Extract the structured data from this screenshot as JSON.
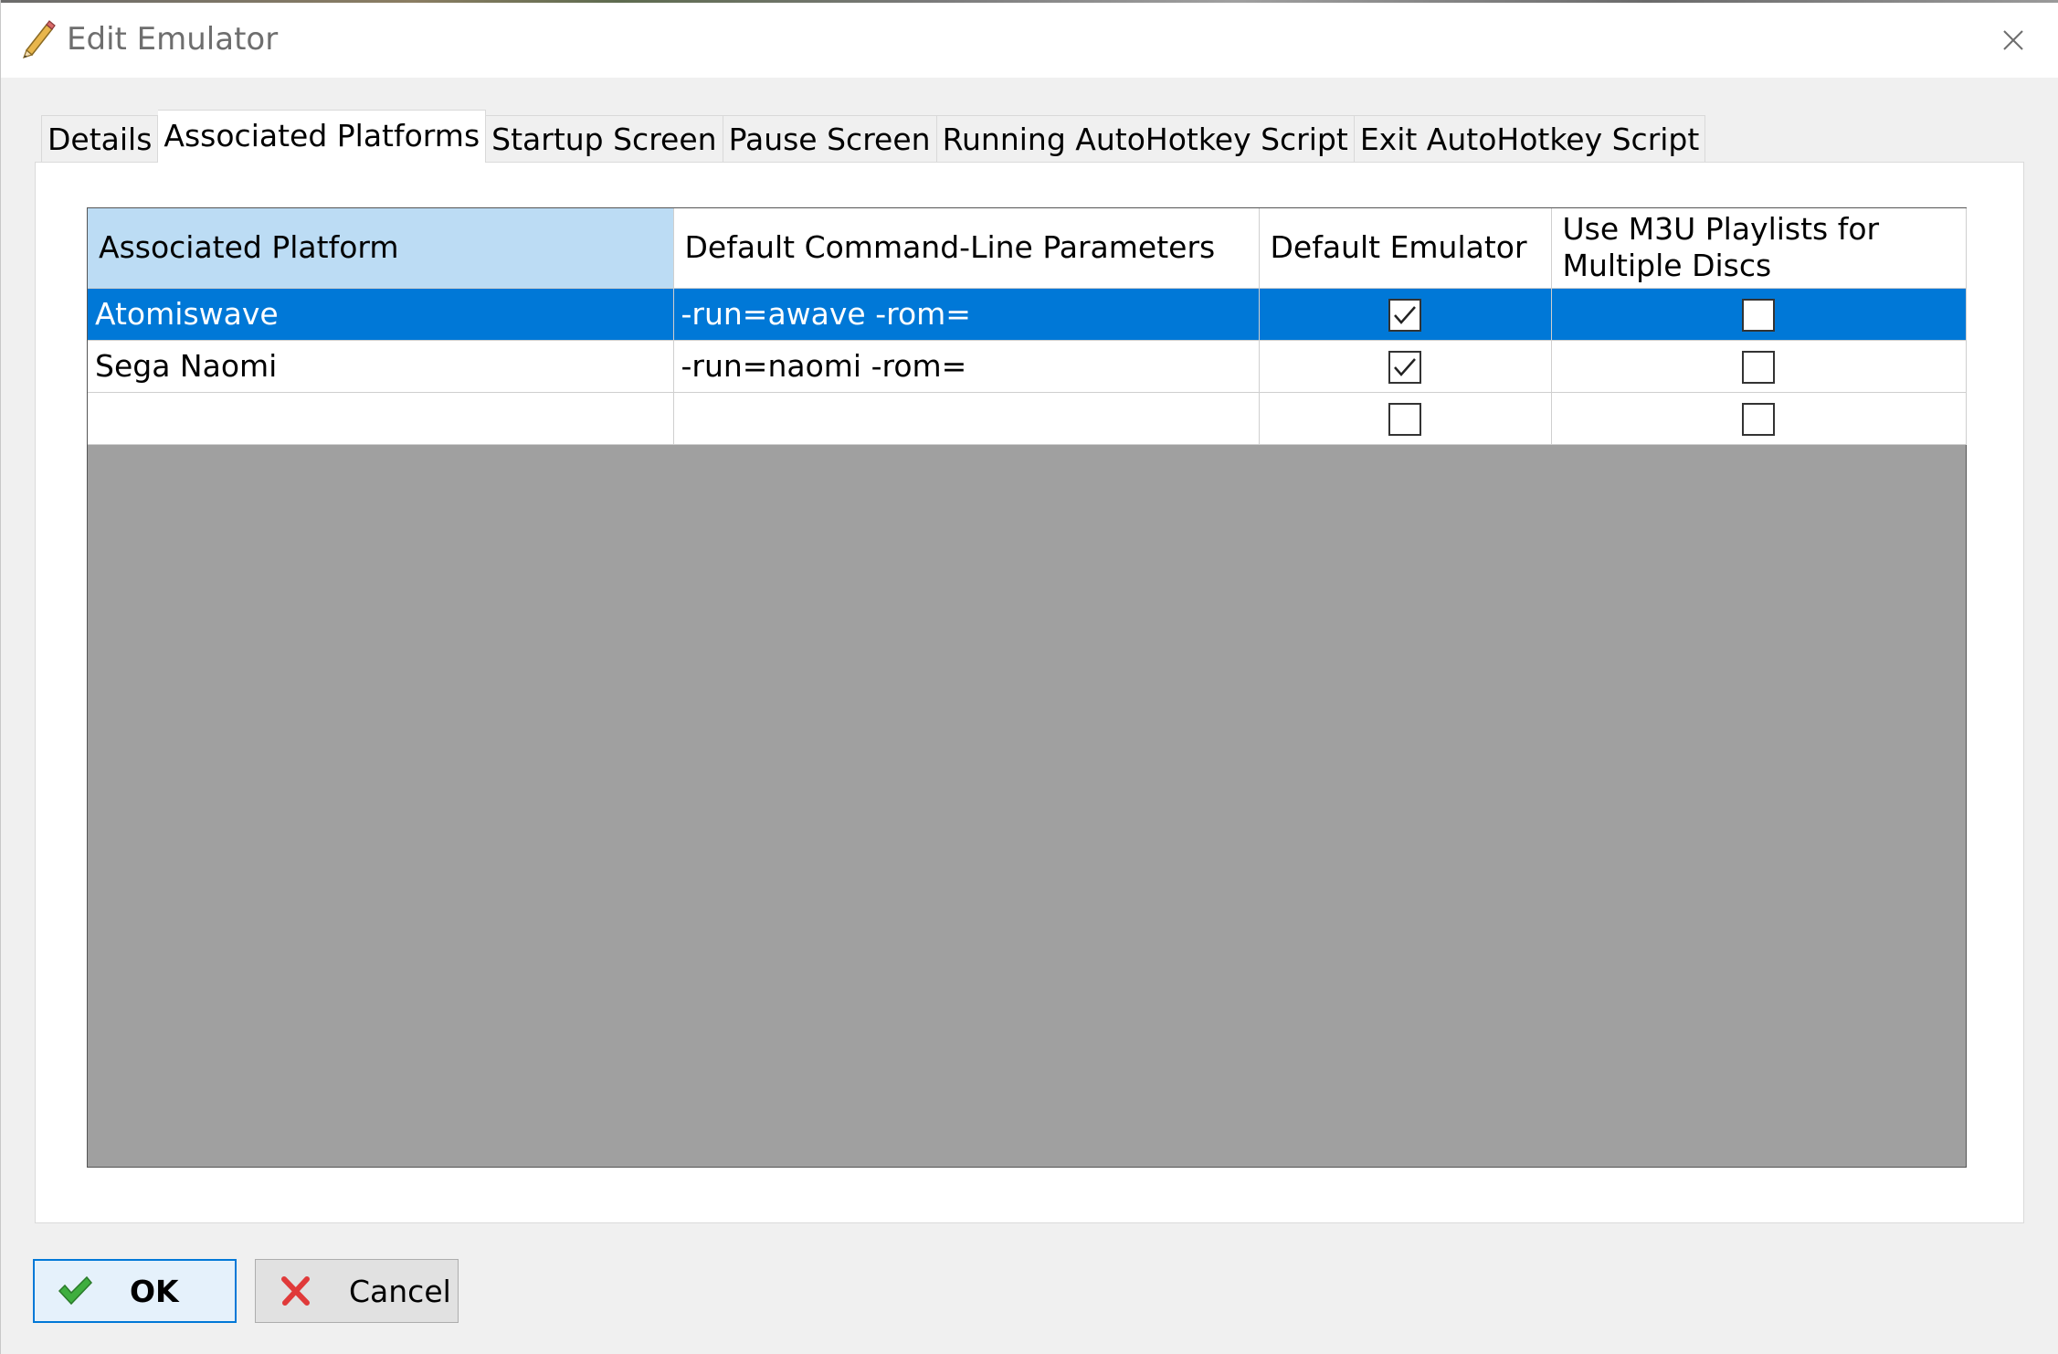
{
  "window": {
    "title": "Edit Emulator",
    "title_icon": "pencil-icon",
    "close_icon": "close-icon"
  },
  "tabs": [
    {
      "label": "Details",
      "active": false
    },
    {
      "label": "Associated Platforms",
      "active": true
    },
    {
      "label": "Startup Screen",
      "active": false
    },
    {
      "label": "Pause Screen",
      "active": false
    },
    {
      "label": "Running AutoHotkey Script",
      "active": false
    },
    {
      "label": "Exit AutoHotkey Script",
      "active": false
    }
  ],
  "grid": {
    "columns": [
      "Associated Platform",
      "Default Command-Line Parameters",
      "Default Emulator",
      "Use M3U Playlists for Multiple Discs"
    ],
    "rows": [
      {
        "platform": "Atomiswave",
        "params": "-run=awave -rom=",
        "default_emulator": true,
        "use_m3u": false,
        "selected": true
      },
      {
        "platform": "Sega Naomi",
        "params": "-run=naomi -rom=",
        "default_emulator": true,
        "use_m3u": false,
        "selected": false
      },
      {
        "platform": "",
        "params": "",
        "default_emulator": false,
        "use_m3u": false,
        "selected": false
      }
    ]
  },
  "buttons": {
    "ok_label": "OK",
    "ok_icon": "checkmark-icon",
    "cancel_label": "Cancel",
    "cancel_icon": "x-icon"
  },
  "colors": {
    "selection": "#0078d7",
    "header_sorted": "#bcdcf4",
    "grid_background": "#a0a0a0"
  }
}
